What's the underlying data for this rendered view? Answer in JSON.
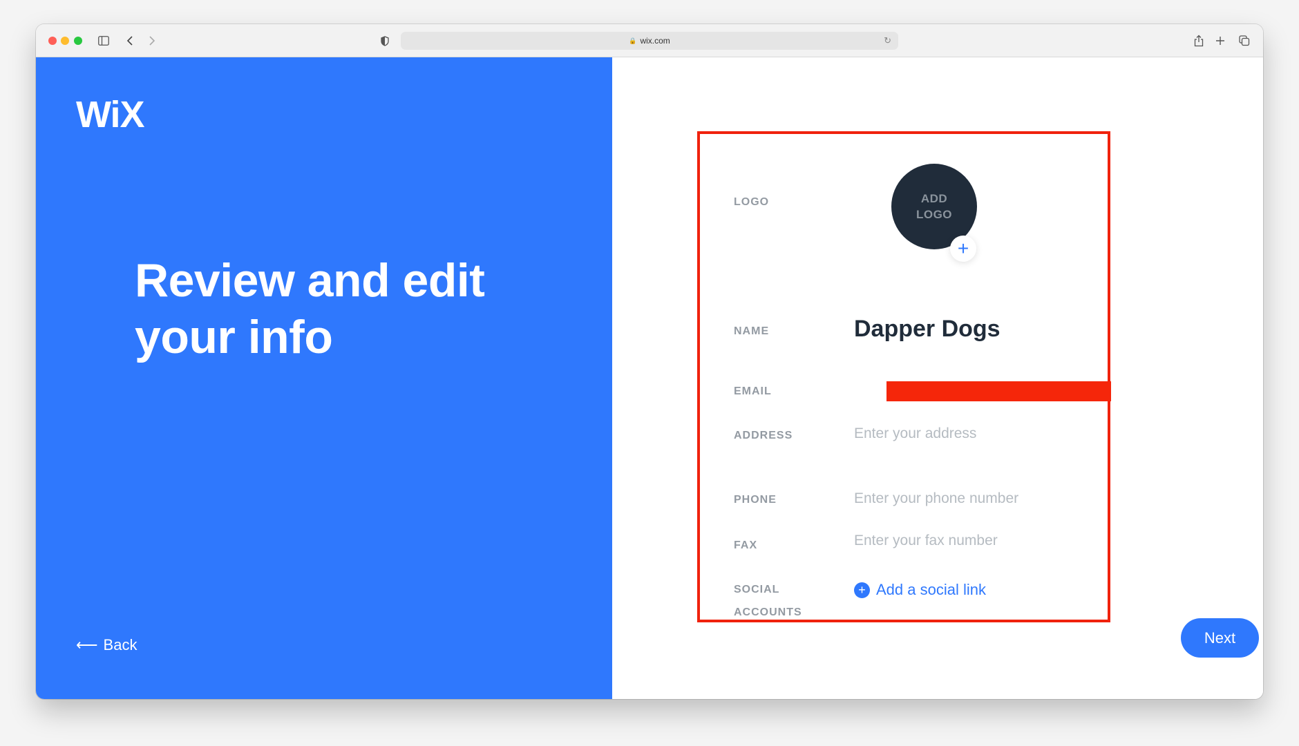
{
  "browser": {
    "url": "wix.com",
    "icons": [
      "sidebar-icon",
      "back-icon",
      "forward-icon",
      "shield-icon",
      "lock-icon",
      "reload-icon",
      "share-icon",
      "new-tab-icon",
      "tabs-icon"
    ],
    "glyphs": {
      "lock": "🔒",
      "reload": "↻",
      "back": "‹",
      "forward": "›",
      "plus": "+"
    }
  },
  "left_panel": {
    "logo": "WiX",
    "headline": "Review and edit your info",
    "back_arrow": "⟵",
    "back_label": "Back",
    "background_color": "#2f78fd"
  },
  "form": {
    "logo": {
      "label": "LOGO",
      "button_line1": "ADD",
      "button_line2": "LOGO",
      "plus": "+"
    },
    "name": {
      "label": "NAME",
      "value": "Dapper Dogs"
    },
    "email": {
      "label": "EMAIL",
      "value": "[redacted]"
    },
    "address": {
      "label": "ADDRESS",
      "placeholder": "Enter your address"
    },
    "phone": {
      "label": "PHONE",
      "placeholder": "Enter your phone number"
    },
    "fax": {
      "label": "FAX",
      "placeholder": "Enter your fax number"
    },
    "social": {
      "label_line1": "SOCIAL",
      "label_line2": "ACCOUNTS",
      "link_icon": "+",
      "link_label": "Add a social link"
    },
    "highlight_color": "#f0220d"
  },
  "actions": {
    "next_label": "Next"
  }
}
